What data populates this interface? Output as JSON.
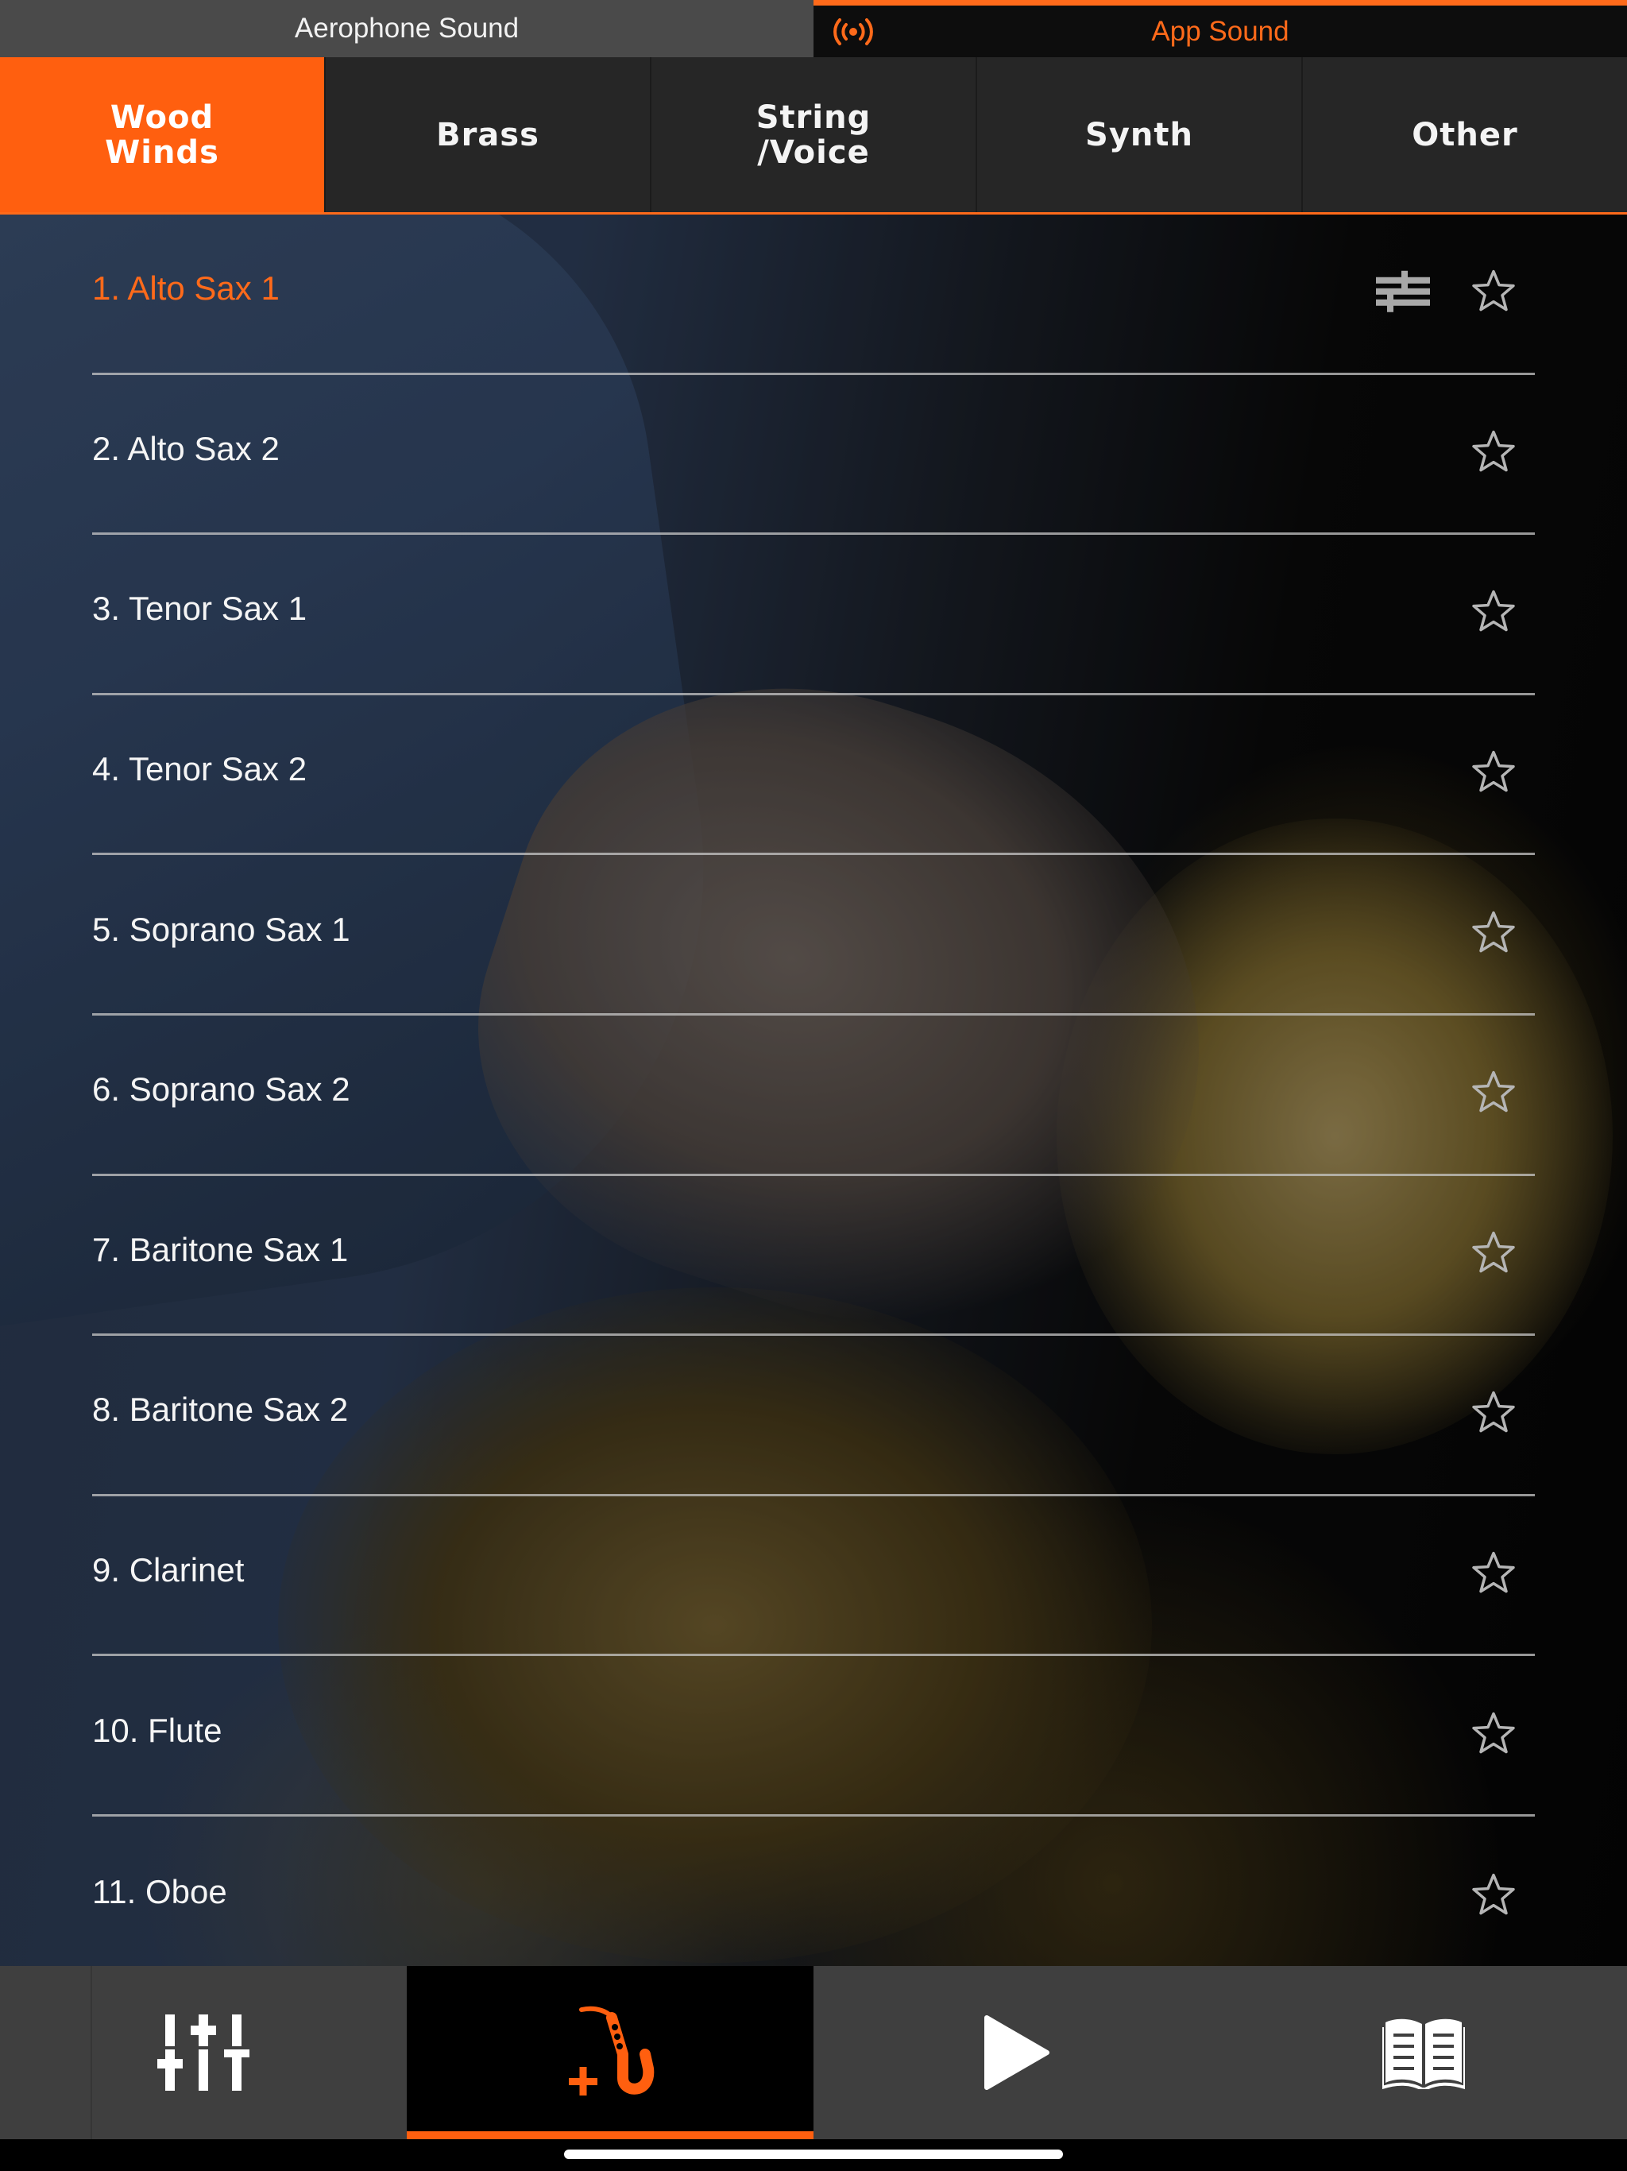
{
  "sound_source": {
    "tabs": [
      {
        "label": "Aerophone Sound",
        "active": false
      },
      {
        "label": "App Sound",
        "active": true
      }
    ]
  },
  "categories": [
    {
      "label": "Wood\nWinds",
      "active": true
    },
    {
      "label": "Brass",
      "active": false
    },
    {
      "label": "String\n/Voice",
      "active": false
    },
    {
      "label": "Synth",
      "active": false
    },
    {
      "label": "Other",
      "active": false
    }
  ],
  "tones": [
    {
      "label": "1. Alto Sax 1",
      "selected": true
    },
    {
      "label": "2. Alto Sax 2",
      "selected": false
    },
    {
      "label": "3. Tenor Sax 1",
      "selected": false
    },
    {
      "label": "4. Tenor Sax 2",
      "selected": false
    },
    {
      "label": "5. Soprano Sax 1",
      "selected": false
    },
    {
      "label": "6. Soprano Sax 2",
      "selected": false
    },
    {
      "label": "7. Baritone Sax 1",
      "selected": false
    },
    {
      "label": "8. Baritone Sax 2",
      "selected": false
    },
    {
      "label": "9. Clarinet",
      "selected": false
    },
    {
      "label": "10. Flute",
      "selected": false
    },
    {
      "label": "11. Oboe",
      "selected": false
    }
  ],
  "icons": {
    "source_indicator": "wireless-signal-icon",
    "favorite": "star-outline-icon",
    "tone_edit": "sliders-edit-icon",
    "nav_mixer": "mixer-sliders-icon",
    "nav_tone": "saxophone-add-icon",
    "nav_play": "play-icon",
    "nav_manual": "open-book-icon"
  },
  "colors": {
    "accent": "#ff6a1a",
    "tab_bar": "#262626",
    "nav_bar": "#3f3f3f"
  }
}
